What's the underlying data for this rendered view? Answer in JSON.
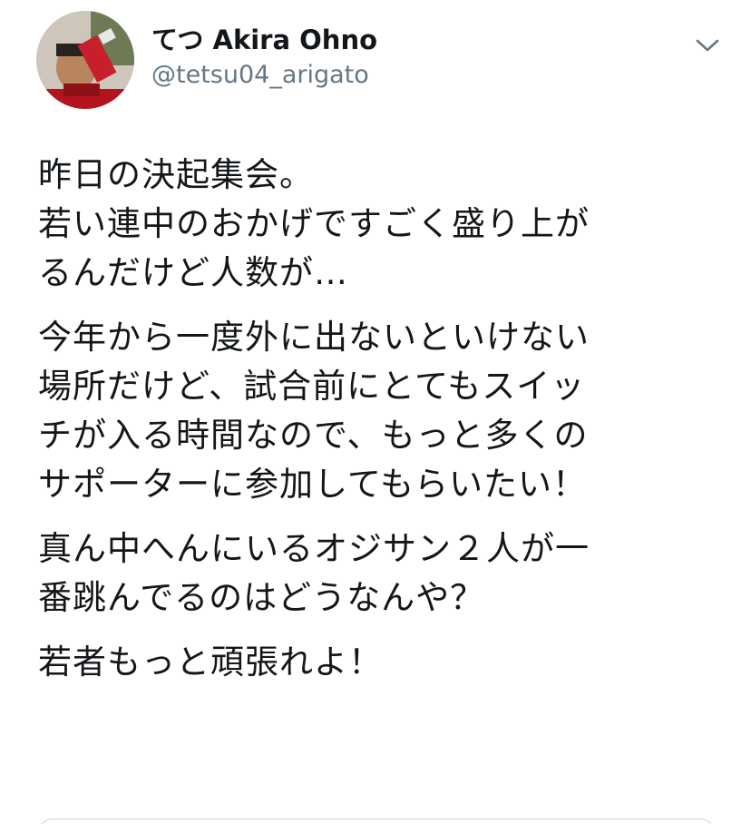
{
  "author": {
    "display_name": "てつ Akira Ohno",
    "handle": "@tetsu04_arigato",
    "avatar_icon": "user-avatar"
  },
  "menu": {
    "icon": "chevron-down-icon"
  },
  "tweet": {
    "paragraphs": [
      [
        "昨日の決起集会。",
        "若い連中のおかげですごく盛り上が",
        "るんだけど人数が…"
      ],
      [
        "今年から一度外に出ないといけない",
        "場所だけど、試合前にとてもスイッ",
        "チが入る時間なので、もっと多くの",
        "サポーターに参加してもらいたい！"
      ],
      [
        "真ん中へんにいるオジサン２人が一",
        "番跳んでるのはどうなんや？"
      ],
      [
        "若者もっと頑張れよ！"
      ]
    ]
  },
  "colors": {
    "text": "#14171a",
    "secondary": "#657786",
    "border": "#ccd6dd"
  }
}
